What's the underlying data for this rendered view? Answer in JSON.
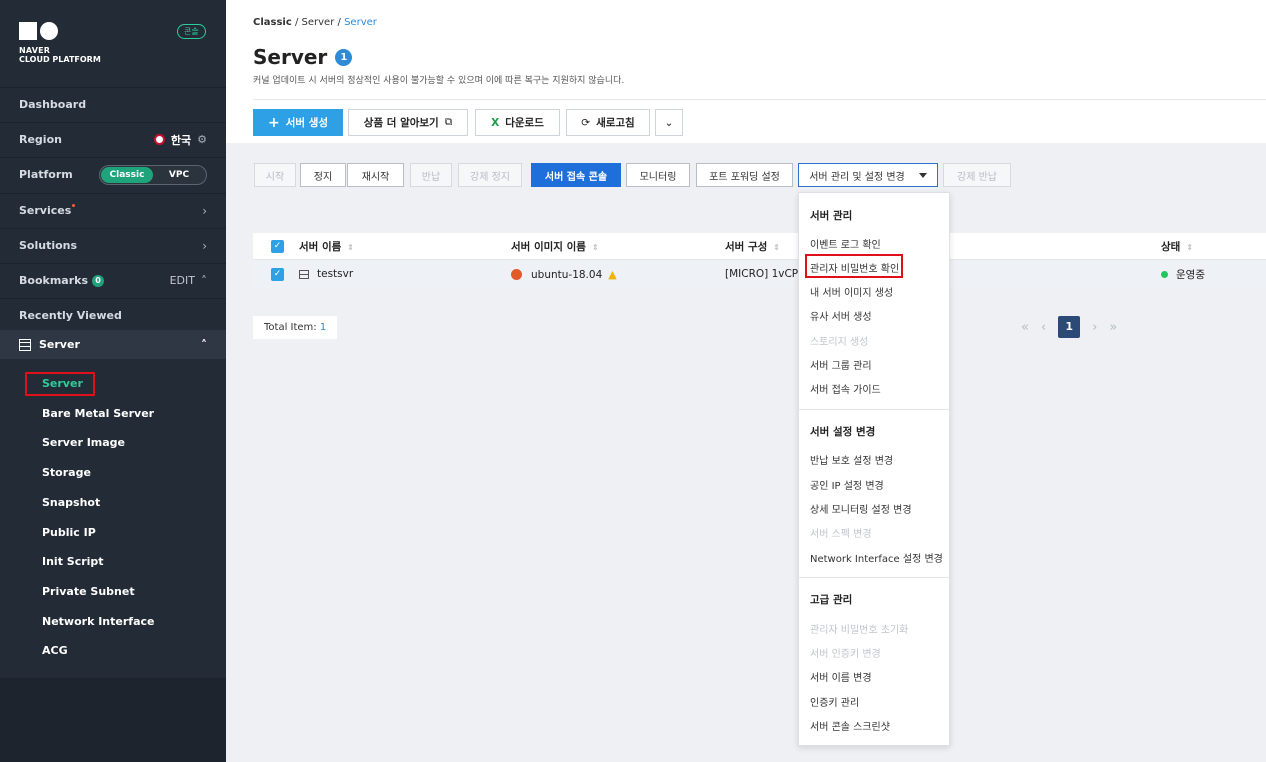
{
  "sidebar": {
    "logo": {
      "line1": "NAVER",
      "line2": "CLOUD PLATFORM"
    },
    "console_badge": "콘솔",
    "dashboard": "Dashboard",
    "region": {
      "label": "Region",
      "value": "한국"
    },
    "platform": {
      "label": "Platform",
      "options": [
        "Classic",
        "VPC"
      ],
      "selected": "Classic"
    },
    "services": "Services",
    "solutions": "Solutions",
    "bookmarks": {
      "label": "Bookmarks",
      "count": "0",
      "edit": "EDIT"
    },
    "recently_viewed": "Recently Viewed",
    "group": "Server",
    "items": [
      "Server",
      "Bare Metal Server",
      "Server Image",
      "Storage",
      "Snapshot",
      "Public IP",
      "Init Script",
      "Private Subnet",
      "Network Interface",
      "ACG"
    ]
  },
  "header": {
    "breadcrumb": [
      "Classic",
      "Server",
      "Server"
    ],
    "title": "Server",
    "title_badge": "1",
    "notice": "커널 업데이트 시 서버의 정상적인 사용이 불가능할 수 있으며 이에 따른 복구는 지원하지 않습니다."
  },
  "toolbar": {
    "create": "서버 생성",
    "learn_more": "상품 더 알아보기",
    "download": "다운로드",
    "refresh": "새로고침"
  },
  "actions": {
    "start": "시작",
    "stop": "정지",
    "restart": "재시작",
    "return": "반납",
    "force_stop": "강제 정지",
    "console": "서버 접속 콘솔",
    "monitoring": "모니터링",
    "port_forwarding": "포트 포워딩 설정",
    "manage": "서버 관리 및 설정 변경",
    "force_return": "강제 반납"
  },
  "table": {
    "columns": [
      "서버 이름",
      "서버 이미지 이름",
      "서버 구성",
      "상태"
    ],
    "rows": [
      {
        "name": "testsvr",
        "image": "ubuntu-18.04",
        "spec": "[MICRO] 1vCPU",
        "status": "운영중"
      }
    ]
  },
  "footer": {
    "total_label": "Total Item:",
    "total_value": "1",
    "current_page": "1"
  },
  "menu": {
    "sec1": "서버 관리",
    "sec1_items": [
      {
        "label": "이벤트 로그 확인",
        "enabled": true
      },
      {
        "label": "관리자 비밀번호 확인",
        "enabled": true
      },
      {
        "label": "내 서버 이미지 생성",
        "enabled": true
      },
      {
        "label": "유사 서버 생성",
        "enabled": true
      },
      {
        "label": "스토리지 생성",
        "enabled": false
      },
      {
        "label": "서버 그룹 관리",
        "enabled": true
      },
      {
        "label": "서버 접속 가이드",
        "enabled": true
      }
    ],
    "sec2": "서버 설정 변경",
    "sec2_items": [
      {
        "label": "반납 보호 설정 변경",
        "enabled": true
      },
      {
        "label": "공인 IP 설정 변경",
        "enabled": true
      },
      {
        "label": "상세 모니터링 설정 변경",
        "enabled": true
      },
      {
        "label": "서버 스펙 변경",
        "enabled": false
      },
      {
        "label": "Network Interface 설정 변경",
        "enabled": true
      }
    ],
    "sec3": "고급 관리",
    "sec3_items": [
      {
        "label": "관리자 비밀번호 초기화",
        "enabled": false
      },
      {
        "label": "서버 인증키 변경",
        "enabled": false
      },
      {
        "label": "서버 이름 변경",
        "enabled": true
      },
      {
        "label": "인증키 관리",
        "enabled": true
      },
      {
        "label": "서버 콘솔 스크린샷",
        "enabled": true
      }
    ]
  },
  "colors": {
    "sidebar_bg": "#232b36",
    "accent_green": "#1fa37b",
    "primary_blue": "#2ea0e6",
    "highlight_red": "#e0101a"
  }
}
